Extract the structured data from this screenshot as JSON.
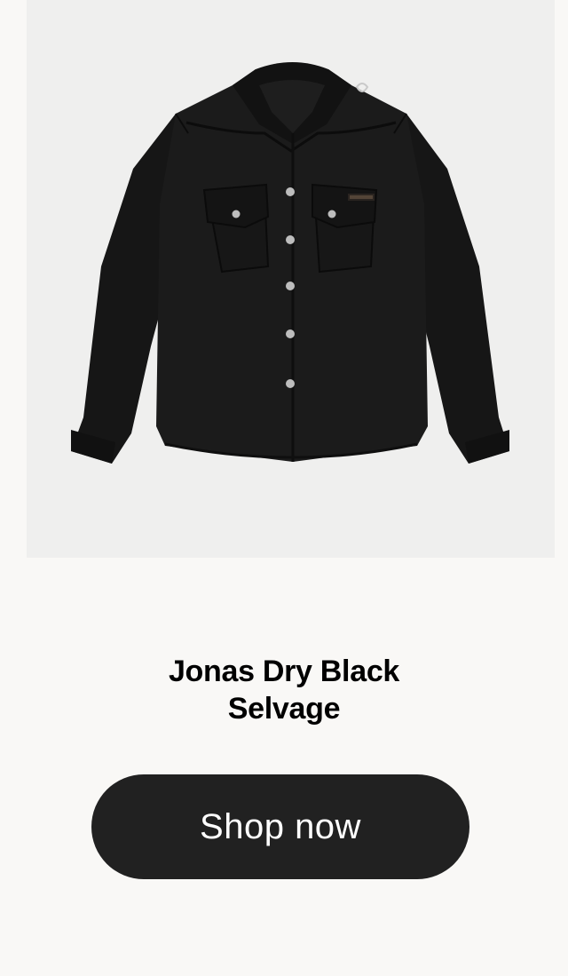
{
  "product": {
    "title_line1": "Jonas Dry Black",
    "title_line2": "Selvage",
    "image_icon": "black-western-shirt-image",
    "image_background": "#efefee"
  },
  "cta": {
    "label": "Shop now",
    "background": "#212121",
    "text_color": "#ffffff"
  },
  "page": {
    "background": "#f9f8f6"
  }
}
